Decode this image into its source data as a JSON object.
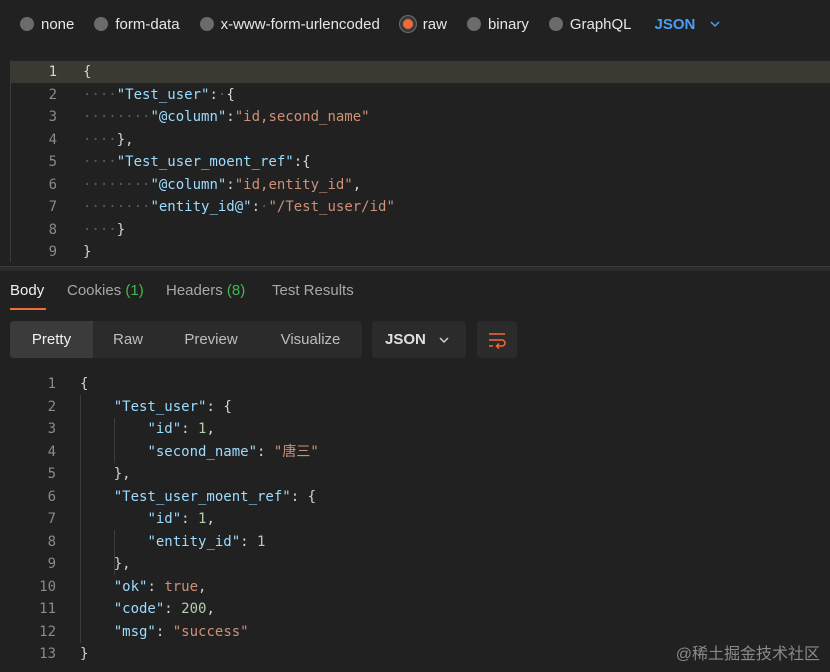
{
  "body_types": [
    {
      "label": "none",
      "selected": false
    },
    {
      "label": "form-data",
      "selected": false
    },
    {
      "label": "x-www-form-urlencoded",
      "selected": false
    },
    {
      "label": "raw",
      "selected": true
    },
    {
      "label": "binary",
      "selected": false
    },
    {
      "label": "GraphQL",
      "selected": false
    }
  ],
  "raw_format": "JSON",
  "request_lines": [
    {
      "n": "1",
      "t": "{"
    },
    {
      "n": "2",
      "t": "    \"Test_user\": {"
    },
    {
      "n": "3",
      "t": "        \"@column\":\"id,second_name\""
    },
    {
      "n": "4",
      "t": "    },"
    },
    {
      "n": "5",
      "t": "    \"Test_user_moent_ref\":{"
    },
    {
      "n": "6",
      "t": "        \"@column\":\"id,entity_id\","
    },
    {
      "n": "7",
      "t": "        \"entity_id@\": \"/Test_user/id\""
    },
    {
      "n": "8",
      "t": "    }"
    },
    {
      "n": "9",
      "t": "}"
    }
  ],
  "response_tabs": {
    "body": "Body",
    "cookies": "Cookies",
    "cookies_count": "(1)",
    "headers": "Headers",
    "headers_count": "(8)",
    "test_results": "Test Results"
  },
  "view_modes": [
    "Pretty",
    "Raw",
    "Preview",
    "Visualize"
  ],
  "response_format": "JSON",
  "response_lines": [
    {
      "n": "1",
      "t": "{"
    },
    {
      "n": "2",
      "t": "    \"Test_user\": {"
    },
    {
      "n": "3",
      "t": "        \"id\": 1,"
    },
    {
      "n": "4",
      "t": "        \"second_name\": \"唐三\""
    },
    {
      "n": "5",
      "t": "    },"
    },
    {
      "n": "6",
      "t": "    \"Test_user_moent_ref\": {"
    },
    {
      "n": "7",
      "t": "        \"id\": 1,"
    },
    {
      "n": "8",
      "t": "        \"entity_id\": 1"
    },
    {
      "n": "9",
      "t": "    },"
    },
    {
      "n": "10",
      "t": "    \"ok\": true,"
    },
    {
      "n": "11",
      "t": "    \"code\": 200,"
    },
    {
      "n": "12",
      "t": "    \"msg\": \"success\""
    },
    {
      "n": "13",
      "t": "}"
    }
  ],
  "watermark": "@稀土掘金技术社区",
  "colors": {
    "accent": "#f26b3a",
    "json_blue": "#4a9ff5",
    "count_green": "#3fb950"
  }
}
